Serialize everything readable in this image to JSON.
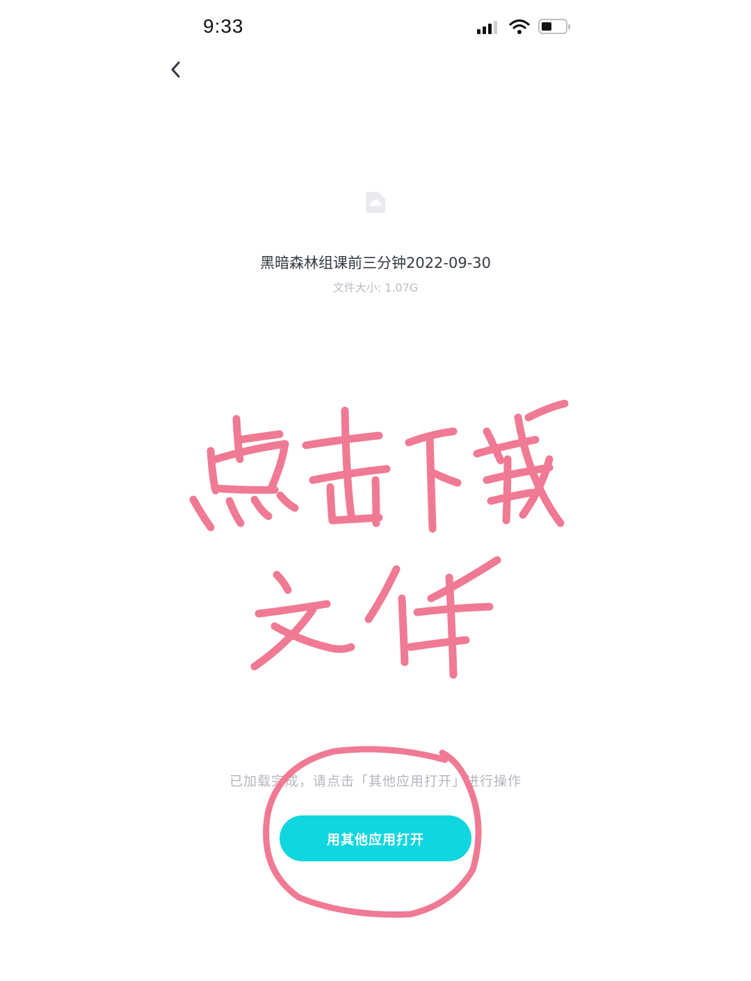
{
  "status_bar": {
    "time": "9:33",
    "icons": [
      "signal-icon",
      "wifi-icon",
      "battery-icon"
    ]
  },
  "nav": {
    "back_icon": "chevron-left-icon"
  },
  "file": {
    "icon": "file-cloud-icon",
    "name": "黑暗森林组课前三分钟2022-09-30",
    "size_text": "文件大小: 1.07G"
  },
  "annotation": {
    "handwritten_text_line1": "点击下载",
    "handwritten_text_line2": "文件",
    "color": "#f07a93"
  },
  "footer": {
    "hint": "已加载完成，请点击「其他应用打开」进行操作",
    "open_button_label": "用其他应用打开"
  },
  "colors": {
    "accent": "#10d6e0",
    "text_primary": "#333840",
    "text_secondary": "#b8bcc4"
  }
}
